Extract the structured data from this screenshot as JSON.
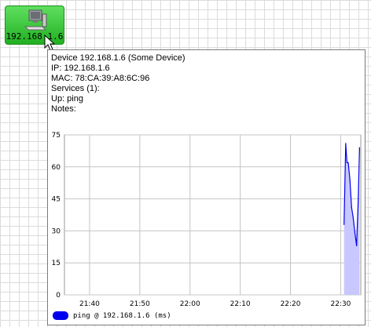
{
  "device_node": {
    "label": "192.168.1.6",
    "icon": "computer-icon",
    "color": "#33cc33"
  },
  "tooltip": {
    "device_line": "Device 192.168.1.6 (Some Device)",
    "ip_line": "IP: 192.168.1.6",
    "mac_line": "MAC: 78:CA:39:A8:6C:96",
    "services_line": "Services (1):",
    "up_line": "Up: ping",
    "notes_line": "Notes:"
  },
  "chart_data": {
    "type": "area",
    "title": "",
    "xlabel": "",
    "ylabel": "",
    "x_ticks": [
      "21:40",
      "21:50",
      "22:00",
      "22:10",
      "22:20",
      "22:30"
    ],
    "y_ticks": [
      "0",
      "15",
      "30",
      "45",
      "60",
      "75"
    ],
    "xlim": [
      "21:35",
      "22:34"
    ],
    "ylim": [
      0,
      75
    ],
    "grid": true,
    "legend_placement": "bottom-left",
    "series": [
      {
        "name": "ping @ 192.168.1.6 (ms)",
        "color": "#0000ee",
        "fill_color": "#c8c8ff",
        "x": [
          "22:30:40",
          "22:31:00",
          "22:31:15",
          "22:31:30",
          "22:31:50",
          "22:32:10",
          "22:32:30",
          "22:32:50",
          "22:33:10",
          "22:33:30",
          "22:33:45"
        ],
        "values": [
          33,
          71,
          62,
          62,
          54,
          41,
          36,
          29,
          23,
          45,
          69
        ]
      }
    ]
  }
}
